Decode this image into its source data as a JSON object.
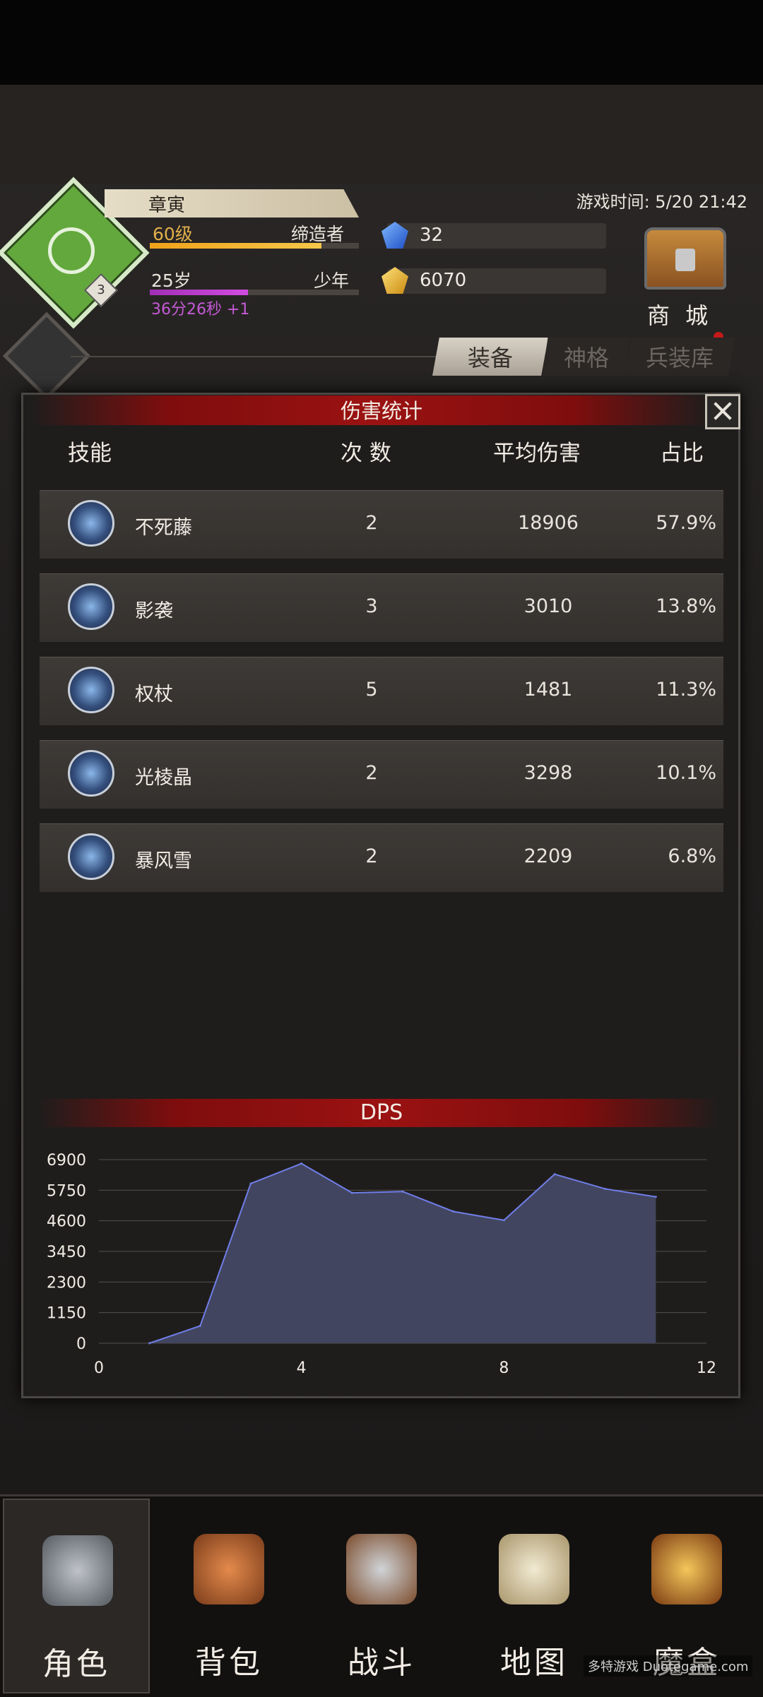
{
  "player": {
    "name": "章寅",
    "level": "60级",
    "title": "缔造者",
    "xp_fraction": 0.82,
    "age": "25岁",
    "life_stage": "少年",
    "age_fraction": 0.47,
    "timer": "36分26秒 +1",
    "rank_number": "3"
  },
  "game_time": "游戏时间: 5/20 21:42",
  "resources": {
    "gems": "32",
    "gold": "6070"
  },
  "shop_label": "商 城",
  "tabs": [
    "装备",
    "神格",
    "兵装库"
  ],
  "modal": {
    "title": "伤害统计",
    "columns": {
      "skill": "技能",
      "count": "次 数",
      "avg": "平均伤害",
      "ratio": "占比"
    },
    "rows": [
      {
        "name": "不死藤",
        "count": "2",
        "avg": "18906",
        "ratio": "57.9%",
        "icon": "vine-lightning-icon"
      },
      {
        "name": "影袭",
        "count": "3",
        "avg": "3010",
        "ratio": "13.8%",
        "icon": "shadow-figure-icon"
      },
      {
        "name": "权杖",
        "count": "5",
        "avg": "1481",
        "ratio": "11.3%",
        "icon": "sword-icon"
      },
      {
        "name": "光棱晶",
        "count": "2",
        "avg": "3298",
        "ratio": "10.1%",
        "icon": "light-prism-icon"
      },
      {
        "name": "暴风雪",
        "count": "2",
        "avg": "2209",
        "ratio": "6.8%",
        "icon": "blizzard-icon"
      }
    ],
    "dps_title": "DPS"
  },
  "chart_data": {
    "type": "area",
    "title": "DPS",
    "x": [
      1,
      2,
      3,
      4,
      5,
      6,
      7,
      8,
      9,
      10,
      11
    ],
    "values": [
      0,
      650,
      6000,
      6750,
      5650,
      5700,
      4950,
      4620,
      6350,
      5800,
      5500
    ],
    "xticks": [
      "0",
      "4",
      "8",
      "12"
    ],
    "yticks": [
      "0",
      "1150",
      "2300",
      "3450",
      "4600",
      "5750",
      "6900"
    ],
    "xlim": [
      0,
      12
    ],
    "ylim": [
      0,
      6900
    ],
    "grid": true,
    "colors": {
      "fill": "#42455f",
      "line": "#6f7ee8"
    }
  },
  "nav": [
    {
      "label": "角色",
      "icon": "helmet-icon",
      "active": true
    },
    {
      "label": "背包",
      "icon": "backpack-icon",
      "active": false
    },
    {
      "label": "战斗",
      "icon": "sword-shield-icon",
      "active": false
    },
    {
      "label": "地图",
      "icon": "scroll-map-icon",
      "active": false
    },
    {
      "label": "魔盒",
      "icon": "magic-box-icon",
      "active": false
    }
  ],
  "watermark": "多特游戏 Duotegame.com"
}
